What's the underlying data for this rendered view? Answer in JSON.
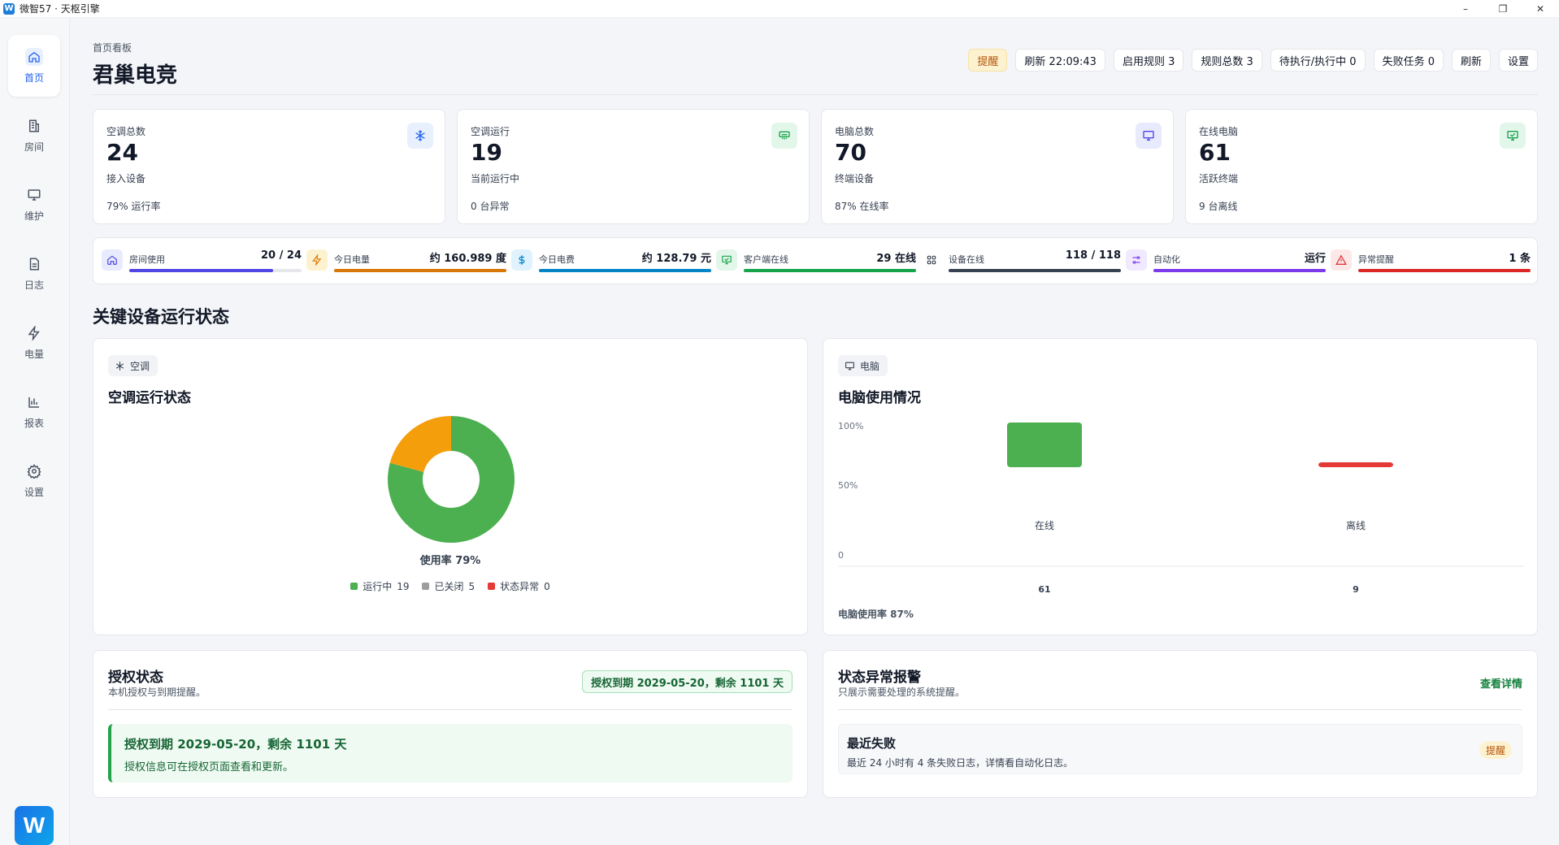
{
  "window": {
    "app_letter": "W",
    "title": "微智57 · 天枢引擎",
    "controls": [
      "–",
      "❐",
      "✕"
    ]
  },
  "sidebar": {
    "items": [
      {
        "label": "首页",
        "icon": "home-icon",
        "active": true
      },
      {
        "label": "房间",
        "icon": "building-icon",
        "active": false
      },
      {
        "label": "维护",
        "icon": "monitor-icon",
        "active": false
      },
      {
        "label": "日志",
        "icon": "document-icon",
        "active": false
      },
      {
        "label": "电量",
        "icon": "lightning-icon",
        "active": false
      },
      {
        "label": "报表",
        "icon": "bar-chart-icon",
        "active": false
      },
      {
        "label": "设置",
        "icon": "gear-icon",
        "active": false
      }
    ],
    "logo_letter": "W"
  },
  "header": {
    "breadcrumb": "首页看板",
    "title": "君巢电竞",
    "pills": {
      "alert": "提醒",
      "refresh_time": "刷新 22:09:43",
      "enabled_rules": "启用规则 3",
      "total_rules": "规则总数 3",
      "pending": "待执行/执行中 0",
      "failed": "失败任务 0",
      "refresh": "刷新",
      "settings": "设置"
    }
  },
  "stats": [
    {
      "label": "空调总数",
      "value": "24",
      "sub": "接入设备",
      "foot": "79% 运行率",
      "icon": "snowflake-icon",
      "icon_bg": "#e8f0fe",
      "icon_color": "#2563eb"
    },
    {
      "label": "空调运行",
      "value": "19",
      "sub": "当前运行中",
      "foot": "0 台异常",
      "icon": "ac-unit-icon",
      "icon_bg": "#e3f6ea",
      "icon_color": "#16a34a"
    },
    {
      "label": "电脑总数",
      "value": "70",
      "sub": "终端设备",
      "foot": "87% 在线率",
      "icon": "monitor-icon",
      "icon_bg": "#e8eafd",
      "icon_color": "#4f46e5"
    },
    {
      "label": "在线电脑",
      "value": "61",
      "sub": "活跃终端",
      "foot": "9 台离线",
      "icon": "monitor-check-icon",
      "icon_bg": "#e3f6ea",
      "icon_color": "#16a34a"
    }
  ],
  "metrics": [
    {
      "label": "房间使用",
      "value": "20 / 24",
      "fill": 0.833,
      "color": "#4f46e5",
      "icon": "home-icon",
      "icon_bg": "#e8eafd",
      "icon_color": "#4f46e5"
    },
    {
      "label": "今日电量",
      "value": "约 160.989 度",
      "fill": 1.0,
      "color": "#d97706",
      "icon": "lightning-icon",
      "icon_bg": "#fdf2d0",
      "icon_color": "#d97706"
    },
    {
      "label": "今日电费",
      "value": "约 128.79 元",
      "fill": 1.0,
      "color": "#0284c7",
      "icon": "dollar-icon",
      "icon_bg": "#e0f2fe",
      "icon_color": "#0284c7"
    },
    {
      "label": "客户端在线",
      "value": "29 在线",
      "fill": 1.0,
      "color": "#16a34a",
      "icon": "monitor-check-icon",
      "icon_bg": "#e3f6ea",
      "icon_color": "#16a34a"
    },
    {
      "label": "设备在线",
      "value": "118 / 118",
      "fill": 1.0,
      "color": "#374151",
      "icon": "grid-icon",
      "icon_bg": "#ffffff",
      "icon_color": "#374151"
    },
    {
      "label": "自动化",
      "value": "运行",
      "fill": 1.0,
      "color": "#7c3aed",
      "icon": "sliders-icon",
      "icon_bg": "#f1e9fe",
      "icon_color": "#7c3aed"
    },
    {
      "label": "异常提醒",
      "value": "1 条",
      "fill": 1.0,
      "color": "#dc2626",
      "icon": "warning-icon",
      "icon_bg": "#fde8e8",
      "icon_color": "#dc2626"
    }
  ],
  "section": {
    "title": "关键设备运行状态"
  },
  "ac_panel": {
    "tag": "空调",
    "title": "空调运行状态"
  },
  "pc_panel": {
    "tag": "电脑",
    "title": "电脑使用情况"
  },
  "chart_data": [
    {
      "type": "pie",
      "donut": true,
      "categories": [
        "运行中",
        "已关闭",
        "状态异常"
      ],
      "values": [
        19,
        5,
        0
      ],
      "colors": [
        "#4caf50",
        "#9e9e9e",
        "#e53935"
      ],
      "center_caption": "使用率 79%",
      "legend": [
        {
          "label": "运行中",
          "count": "19"
        },
        {
          "label": "已关闭",
          "count": "5"
        },
        {
          "label": "状态异常",
          "count": "0"
        }
      ],
      "slice_colors_drawn": [
        "#4caf50",
        "#f59e0b"
      ]
    },
    {
      "type": "bar",
      "categories": [
        "在线",
        "离线"
      ],
      "values": [
        61,
        9
      ],
      "count_labels": [
        "61",
        "9"
      ],
      "colors": [
        "#4caf50",
        "#e53935"
      ],
      "ytick_labels": [
        "100%",
        "50%",
        "0"
      ],
      "caption": "电脑使用率 87%"
    }
  ],
  "license": {
    "title": "授权状态",
    "subtitle": "本机授权与到期提醒。",
    "badge": "授权到期 2029-05-20，剩余 1101 天",
    "box_title": "授权到期 2029-05-20，剩余 1101 天",
    "box_text": "授权信息可在授权页面查看和更新。"
  },
  "alerts": {
    "title": "状态异常报警",
    "subtitle": "只展示需要处理的系统提醒。",
    "link": "查看详情",
    "row_title": "最近失败",
    "row_text": "最近 24 小时有 4 条失败日志，详情看自动化日志。",
    "row_badge": "提醒"
  }
}
